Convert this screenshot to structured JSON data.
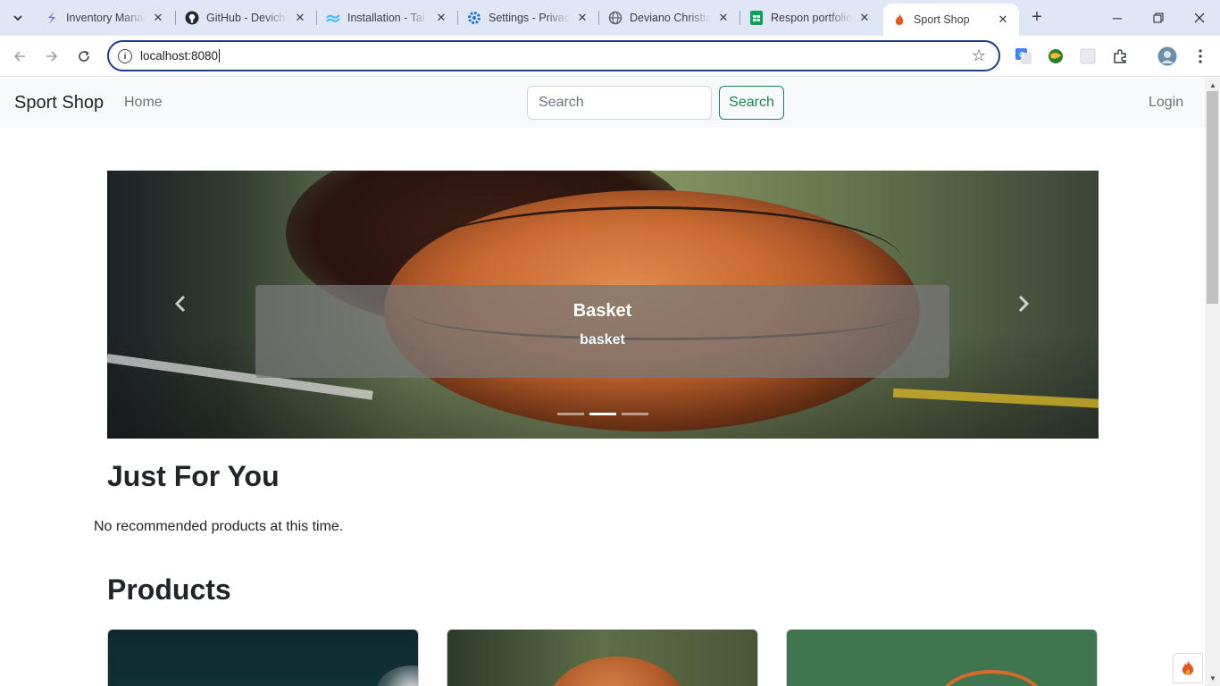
{
  "browser": {
    "tabs": [
      {
        "title": "Inventory Manag",
        "favicon": "stackbit-icon"
      },
      {
        "title": "GitHub - Devich",
        "favicon": "github-icon"
      },
      {
        "title": "Installation - Tai",
        "favicon": "tailwind-icon"
      },
      {
        "title": "Settings - Privac",
        "favicon": "gear-icon"
      },
      {
        "title": "Deviano Christia",
        "favicon": "globe-icon"
      },
      {
        "title": "Respon portfolio",
        "favicon": "sheets-icon"
      },
      {
        "title": "Sport Shop",
        "favicon": "flame-icon",
        "active": true
      }
    ],
    "url": "localhost:8080"
  },
  "navbar": {
    "brand": "Sport Shop",
    "home": "Home",
    "search_placeholder": "Search",
    "search_button": "Search",
    "login": "Login"
  },
  "carousel": {
    "caption_title": "Basket",
    "caption_text": "basket",
    "slides": 3,
    "active_slide": 2
  },
  "sections": {
    "just_for_you": "Just For You",
    "no_recommended": "No recommended products at this time.",
    "products": "Products"
  },
  "colors": {
    "accent_green": "#198754",
    "omnibox_border": "#1a3d8f",
    "tabstrip_bg": "#dfe6f5"
  }
}
